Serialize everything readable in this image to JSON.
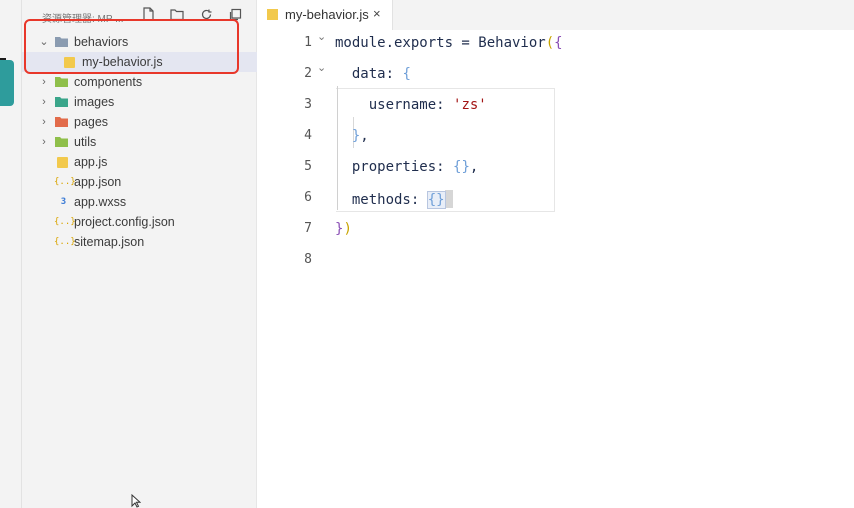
{
  "explorer": {
    "title": "资源管理器: MP ...",
    "tools": [
      "new-file-icon",
      "new-folder-icon",
      "refresh-icon",
      "collapse-all-icon"
    ]
  },
  "tree": [
    {
      "label": "behaviors",
      "type": "folder-open",
      "expanded": true,
      "depth": 0,
      "color": "#8a9bb0"
    },
    {
      "label": "my-behavior.js",
      "type": "js",
      "depth": 1,
      "selected": true
    },
    {
      "label": "components",
      "type": "folder",
      "depth": 0,
      "color": "#8fbf4a"
    },
    {
      "label": "images",
      "type": "folder",
      "depth": 0,
      "color": "#3aa58a"
    },
    {
      "label": "pages",
      "type": "folder",
      "depth": 0,
      "color": "#e26b4a"
    },
    {
      "label": "utils",
      "type": "folder",
      "depth": 0,
      "color": "#8fbf4a"
    },
    {
      "label": "app.js",
      "type": "js",
      "depth": 0
    },
    {
      "label": "app.json",
      "type": "json",
      "depth": 0
    },
    {
      "label": "app.wxss",
      "type": "wxss",
      "depth": 0
    },
    {
      "label": "project.config.json",
      "type": "json",
      "depth": 0
    },
    {
      "label": "sitemap.json",
      "type": "json",
      "depth": 0
    }
  ],
  "editor": {
    "tab": {
      "label": "my-behavior.js",
      "close": "×"
    },
    "line_numbers": [
      "1",
      "2",
      "3",
      "4",
      "5",
      "6",
      "7",
      "8"
    ],
    "code": {
      "l1_a": "module.exports = Behavior",
      "l1_b": "(",
      "l1_c": "{",
      "l2_a": "  data: ",
      "l2_b": "{",
      "l3_a": "    username: ",
      "l3_b": "'zs'",
      "l4_a": "  ",
      "l4_b": "}",
      "l4_c": ",",
      "l5_a": "  properties: ",
      "l5_b": "{}",
      "l5_c": ",",
      "l6_a": "  methods: ",
      "l6_b": "{}",
      "l7_a": "}",
      "l7_b": ")"
    }
  },
  "colors": {
    "highlight": "#e8372a",
    "string": "#a31515",
    "brace_outer": "#c8a400",
    "brace_inner": "#6f9fd8"
  }
}
